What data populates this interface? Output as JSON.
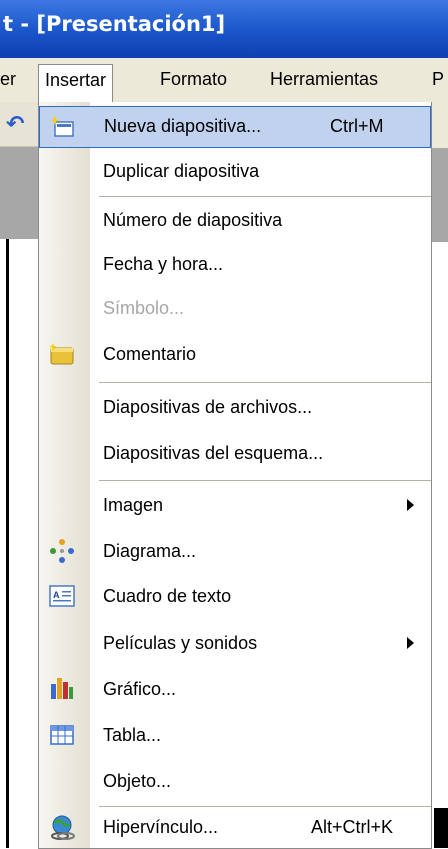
{
  "window": {
    "title": "t - [Presentación1]"
  },
  "menubar": {
    "items": [
      "er",
      "Insertar",
      "Formato",
      "Herramientas",
      "P"
    ]
  },
  "menu": {
    "items": [
      {
        "label": "Nueva diapositiva...",
        "shortcut": "Ctrl+M",
        "icon": "new-slide-icon",
        "state": "highlighted"
      },
      {
        "label": "Duplicar diapositiva"
      },
      {
        "label": "Número de diapositiva"
      },
      {
        "label": "Fecha y hora..."
      },
      {
        "label": "Símbolo...",
        "state": "disabled"
      },
      {
        "label": "Comentario",
        "icon": "comment-icon"
      },
      {
        "label": "Diapositivas de archivos..."
      },
      {
        "label": "Diapositivas del esquema..."
      },
      {
        "label": "Imagen",
        "submenu": true
      },
      {
        "label": "Diagrama...",
        "icon": "diagram-icon"
      },
      {
        "label": "Cuadro de texto",
        "icon": "textbox-icon"
      },
      {
        "label": "Películas y sonidos",
        "submenu": true
      },
      {
        "label": "Gráfico...",
        "icon": "chart-icon"
      },
      {
        "label": "Tabla...",
        "icon": "table-icon"
      },
      {
        "label": "Objeto..."
      },
      {
        "label": "Hipervínculo...",
        "shortcut": "Alt+Ctrl+K",
        "icon": "hyperlink-icon"
      }
    ]
  },
  "colors": {
    "titlebar": "#1a55c9",
    "menu_highlight": "#c1d2ee",
    "highlight_border": "#316ac5",
    "menubar_bg": "#ece9d8"
  }
}
